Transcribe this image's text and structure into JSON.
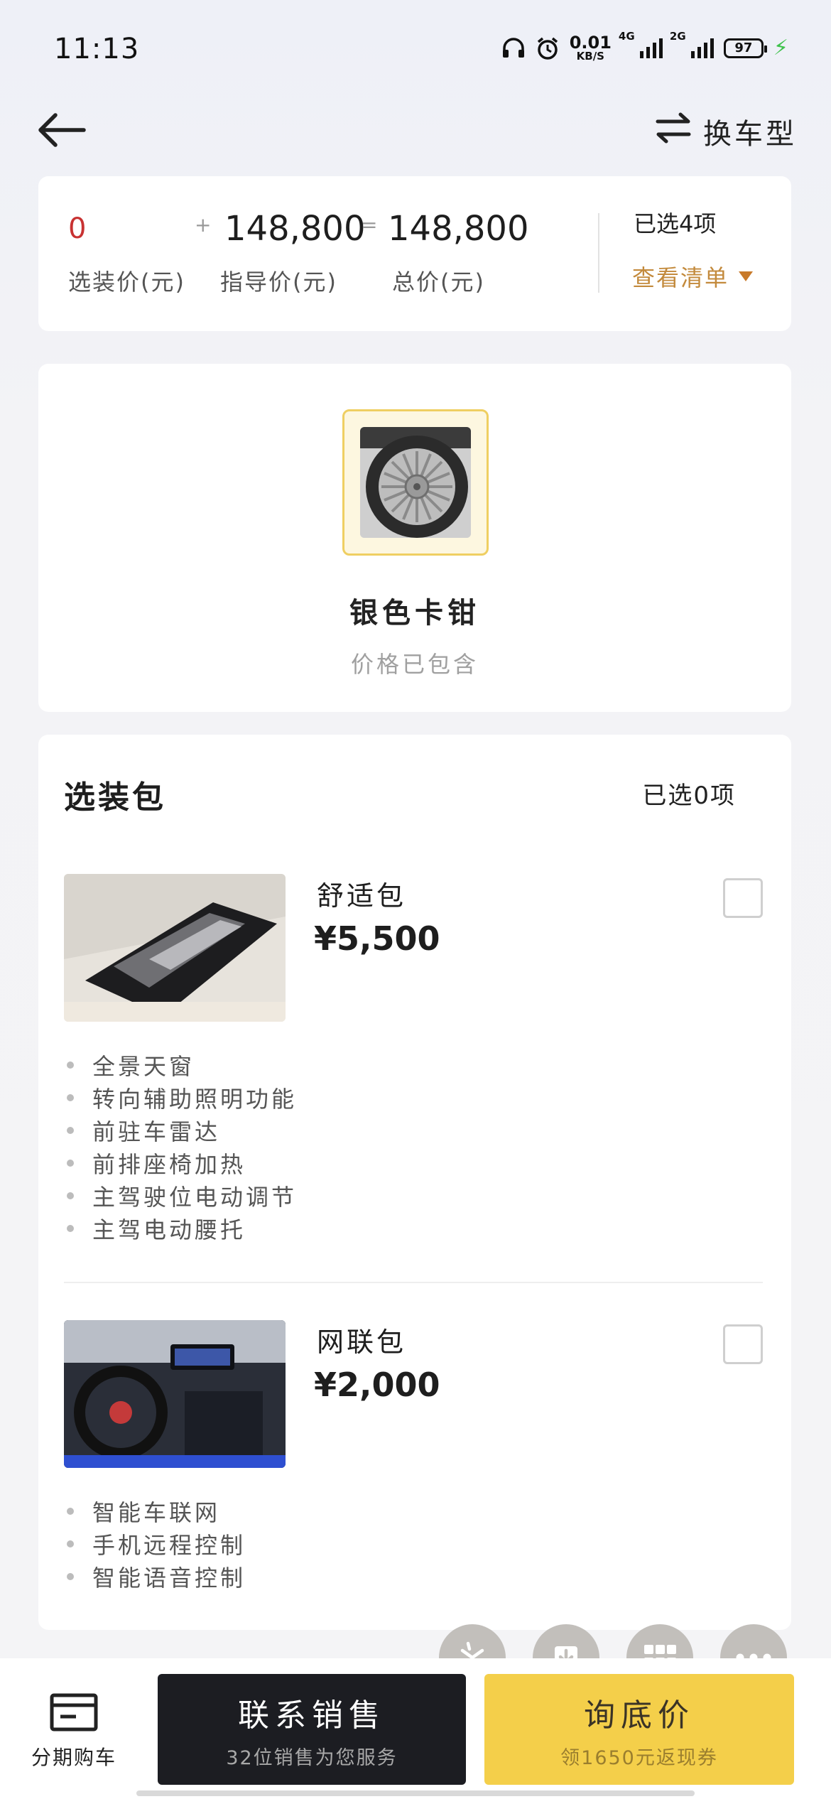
{
  "status_bar": {
    "time": "11:13",
    "net_speed_value": "0.01",
    "net_speed_unit": "KB/S",
    "signal1_label": "4G",
    "signal2_label": "2G",
    "battery": "97",
    "icons": [
      "headphones-icon",
      "alarm-icon",
      "signal-icon",
      "battery-icon",
      "charging-icon"
    ]
  },
  "nav": {
    "switch_label": "换车型",
    "icons": [
      "back-arrow-icon",
      "swap-icon"
    ]
  },
  "price_summary": {
    "option_price": "0",
    "plus": "+",
    "guide_price": "148,800",
    "equals": "=",
    "total_price": "148,800",
    "option_price_label": "选装价(元)",
    "guide_price_label": "指导价(元)",
    "total_price_label": "总价(元)",
    "selected_count": "已选4项",
    "view_list": "查看清单"
  },
  "wheel": {
    "name": "银色卡钳",
    "note": "价格已包含"
  },
  "packages": {
    "title": "选装包",
    "selected_count": "已选0项",
    "items": [
      {
        "name": "舒适包",
        "price": "¥5,500",
        "checked": false,
        "features": [
          "全景天窗",
          "转向辅助照明功能",
          "前驻车雷达",
          "前排座椅加热",
          "主驾驶位电动调节",
          "主驾电动腰托"
        ]
      },
      {
        "name": "网联包",
        "price": "¥2,000",
        "checked": false,
        "features": [
          "智能车联网",
          "手机远程控制",
          "智能语音控制"
        ]
      }
    ]
  },
  "floating_buttons": [
    "sparkle-icon",
    "download-icon",
    "grid-icon",
    "more-icon"
  ],
  "bottom_bar": {
    "installment_label": "分期购车",
    "contact_main": "联系销售",
    "contact_sub": "32位销售为您服务",
    "price_main": "询底价",
    "price_sub": "领1650元返现券"
  },
  "colors": {
    "accent_yellow": "#f4cf4a",
    "dark_button": "#1c1d22",
    "price_red": "#c83232",
    "link_orange": "#c38a3c"
  }
}
